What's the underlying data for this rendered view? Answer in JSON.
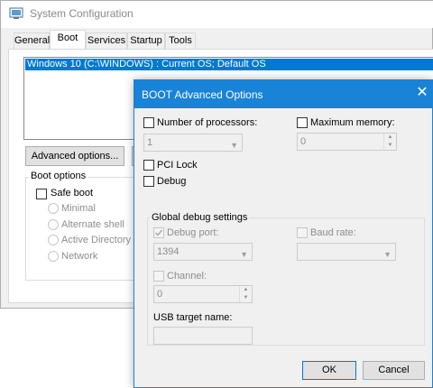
{
  "bg_window": {
    "title": "System Configuration",
    "icon": "msconfig-icon",
    "tabs": [
      "General",
      "Boot",
      "Services",
      "Startup",
      "Tools"
    ],
    "active_tab": "Boot",
    "os_list": [
      "Windows 10 (C:\\WINDOWS) : Current OS; Default OS"
    ],
    "advanced_button": "Advanced options...",
    "boot_options": {
      "label": "Boot options",
      "safe_boot": "Safe boot",
      "radios": [
        "Minimal",
        "Alternate shell",
        "Active Directory re",
        "Network"
      ]
    }
  },
  "dialog": {
    "title": "BOOT Advanced Options",
    "close_glyph": "✕",
    "num_processors": {
      "label": "Number of processors:",
      "value": "1"
    },
    "max_memory": {
      "label": "Maximum memory:",
      "value": "0"
    },
    "pci_lock": "PCI Lock",
    "debug": "Debug",
    "global_debug": {
      "label": "Global debug settings",
      "debug_port": {
        "label": "Debug port:",
        "value": "1394",
        "checked": true
      },
      "baud_rate": {
        "label": "Baud rate:",
        "value": ""
      },
      "channel": {
        "label": "Channel:",
        "value": "0"
      },
      "usb_target": {
        "label": "USB target name:",
        "value": ""
      }
    },
    "ok": "OK",
    "cancel": "Cancel"
  },
  "colors": {
    "accent": "#1883d7",
    "selection": "#0078d7",
    "disabled_text": "#8d8d8d"
  }
}
